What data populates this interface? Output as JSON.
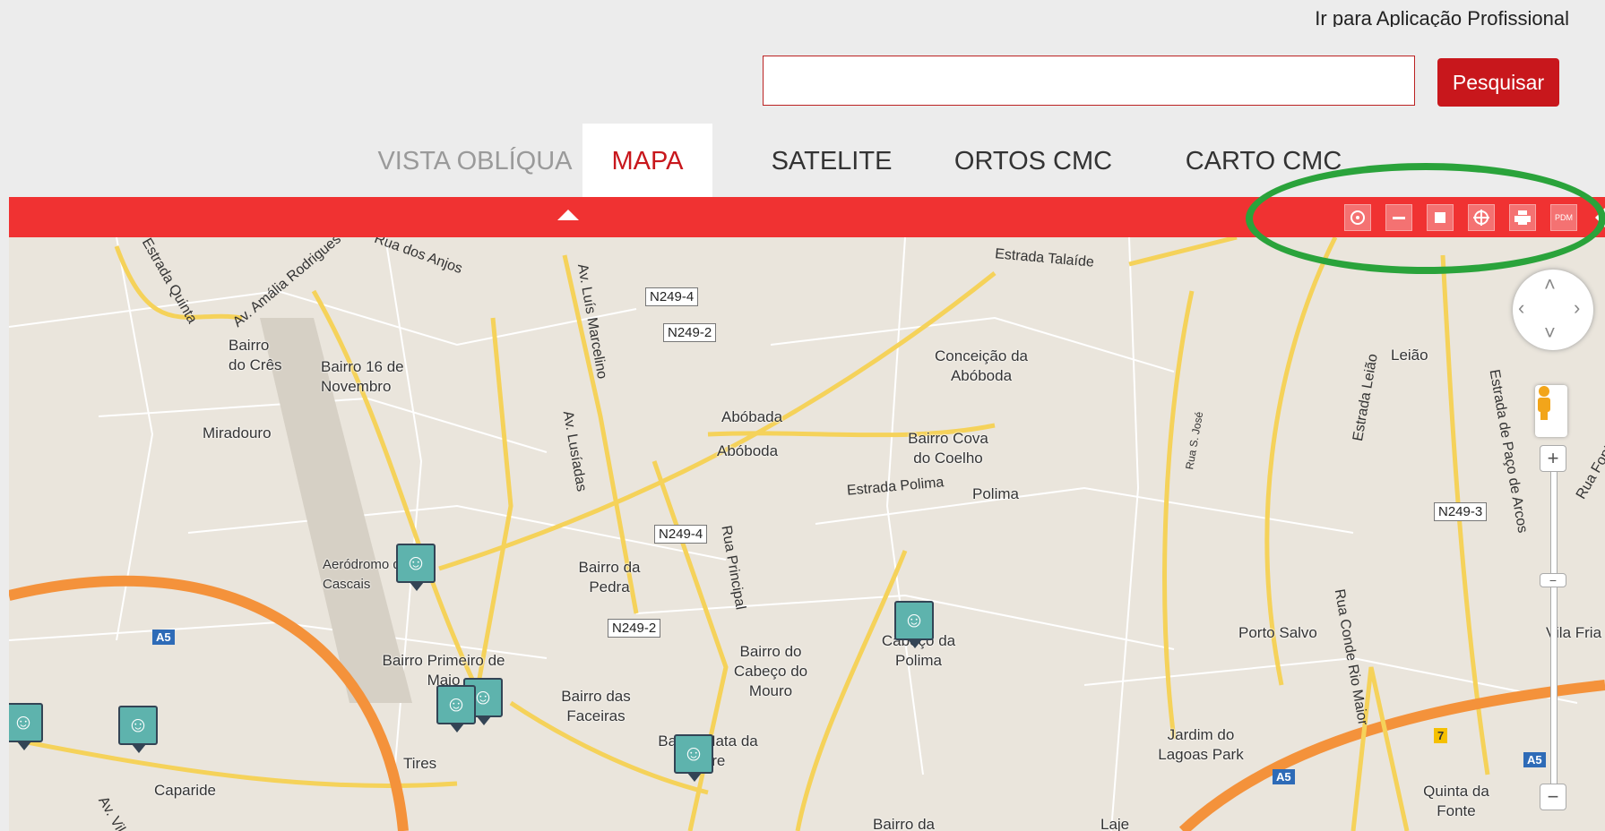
{
  "header": {
    "pro_link": "Ir para Aplicação Profissional",
    "search_placeholder": "",
    "search_button": "Pesquisar"
  },
  "tabs": [
    {
      "label": "VISTA OBLÍQUA",
      "state": "muted"
    },
    {
      "label": "MAPA",
      "state": "active"
    },
    {
      "label": "SATELITE",
      "state": "normal"
    },
    {
      "label": "ORTOS CMC",
      "state": "normal"
    },
    {
      "label": "CARTO CMC",
      "state": "normal"
    }
  ],
  "toolbar": {
    "tools": [
      "target-tool-icon",
      "line-tool-icon",
      "area-tool-icon",
      "crosshair-tool-icon",
      "print-icon",
      "pdm-icon"
    ],
    "pdm_label": "PDM"
  },
  "colors": {
    "accent_red": "#c8171c",
    "bar_red": "#f03232",
    "highlight_green": "#2aa33b",
    "marker_teal": "#5eb3ad"
  },
  "map": {
    "places": [
      "Bairro do Crês",
      "Bairro 16 de Novembro",
      "Miradouro",
      "Aeródromo de Cascais",
      "Bairro da Pedra",
      "Abóbada",
      "Abóboda",
      "Conceição da Abóboda",
      "Bairro Cova do Coelho",
      "Polima",
      "Bairro Primeiro de Maio",
      "Bairro das Faceiras",
      "Bairro do Cabeço do Mouro",
      "Cabeço da Polima",
      "Bairro Mata da Torre",
      "Tires",
      "Caparide",
      "Porto Salvo",
      "Leião",
      "Vila Fria",
      "Jardim do Lagoas Park",
      "Quinta da Fonte",
      "Bairro da",
      "Laje"
    ],
    "roads": [
      "Estrada Quinta",
      "Av. Amália Rodrigues",
      "Av. Luís Marcelino",
      "Av. Lusíadas",
      "Rua Principal",
      "Estrada Polima",
      "Estrada Talaíde",
      "Rua S. José",
      "Estrada Leião",
      "Rua Conde Rio Maior",
      "Estrada de Paço de Arcos",
      "Rua Fonte",
      "Av. Vila",
      "Rua dos Anjos"
    ],
    "shields": [
      "N249-4",
      "N249-2",
      "N249-4",
      "N249-2",
      "N249-3"
    ],
    "highways": [
      "A5",
      "A5",
      "A5",
      "7"
    ],
    "marker_icon": "theater-masks-icon"
  }
}
